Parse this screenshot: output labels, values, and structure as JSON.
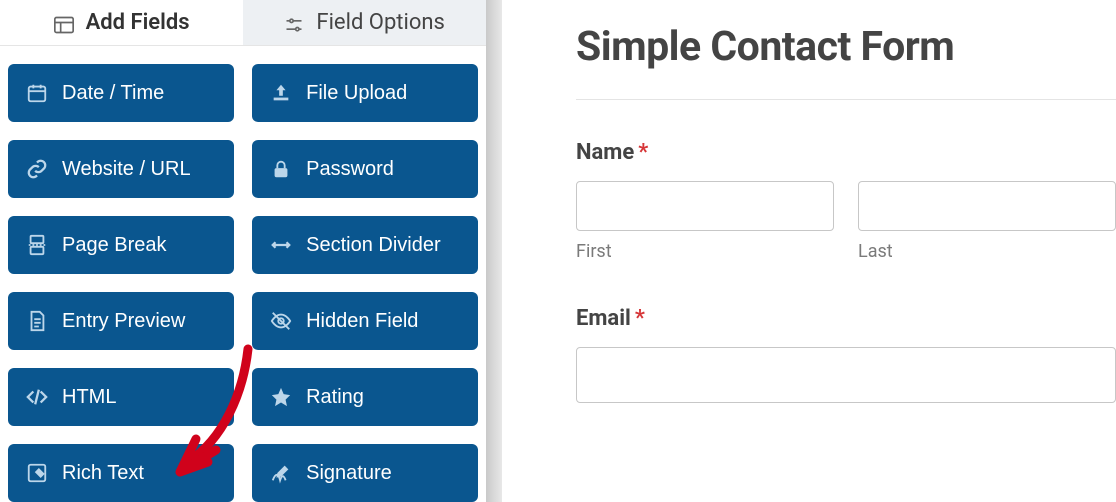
{
  "tabs": {
    "add_fields": "Add Fields",
    "field_options": "Field Options"
  },
  "fields": {
    "date_time": "Date / Time",
    "file_upload": "File Upload",
    "website_url": "Website / URL",
    "password": "Password",
    "page_break": "Page Break",
    "section_divider": "Section Divider",
    "entry_preview": "Entry Preview",
    "hidden_field": "Hidden Field",
    "html": "HTML",
    "rating": "Rating",
    "rich_text": "Rich Text",
    "signature": "Signature"
  },
  "preview": {
    "title": "Simple Contact Form",
    "name_label": "Name",
    "first_sublabel": "First",
    "last_sublabel": "Last",
    "email_label": "Email",
    "required_mark": "*"
  }
}
